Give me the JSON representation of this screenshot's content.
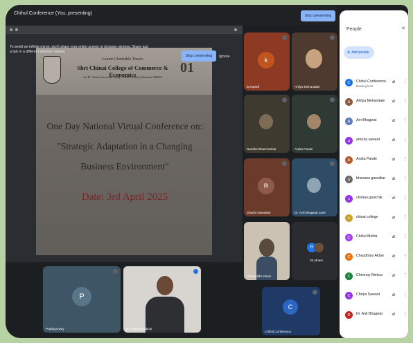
{
  "topbar": {
    "title": "Chihul Conference (You, presenting)",
    "stop_label": "Stop presenting"
  },
  "stage": {
    "notice": "To avoid an infinite mirror, don't share your entire screen or browser window. Share just a tab or a different window instead.",
    "stop_label": "Stop presenting",
    "ignore_label": "Ignore"
  },
  "slide": {
    "org_line1": "Laxmi Charitable Trust's",
    "org_line2": "Shri Chinai College of Commerce & Economics",
    "org_line3": "Sir M. Vishweshwariya Marg, Andheri (East), Mumbai 400069",
    "title_line1": "One Day National Virtual Conference on:",
    "title_line2": "\"Strategic Adaptation in a Changing",
    "title_line3": "Business Environment\"",
    "date": "Date: 3rd April 2025",
    "crest_mark": "01"
  },
  "tiles": [
    {
      "name": "kempsell",
      "initial": "k",
      "bg": "#8d3a24",
      "avatar_bg": "#c2541f"
    },
    {
      "name": "Ahilya Mehandale",
      "bg": "#4e3a2e"
    },
    {
      "name": "Nandini Bhasmankar",
      "bg": "#3f3a30"
    },
    {
      "name": "Arpita Pande",
      "bg": "#2f3a35"
    },
    {
      "name": "Shashi Hawaldar",
      "initial": "R",
      "bg": "#6a3b2b",
      "avatar_bg": "#8e5a47"
    },
    {
      "name": "Dr. Anil Bhagwat Jane",
      "bg": "#2f4c66"
    },
    {
      "name": "Shreenidhi Yelwe",
      "bg": "#cbc2b3"
    },
    {
      "name": "26 others",
      "bg": "#2a2c30"
    },
    {
      "name": "Pradnya Dey",
      "initial": "P",
      "bg": "#3e5566",
      "avatar_bg": "#587687"
    },
    {
      "name": "Dr. Prasad Sabnis",
      "bg": "#d8d4cf"
    },
    {
      "name": "Chihul Conference",
      "initial": "C",
      "bg": "#1f3a66",
      "avatar_bg": "#2c66c3"
    }
  ],
  "panel": {
    "title": "People",
    "close_icon": "close-icon",
    "add_label": "Add people",
    "people": [
      {
        "name": "Chihul Conference",
        "sub": "Meeting host",
        "initial": "C",
        "color": "#1a73e8"
      },
      {
        "name": "Ahilya Mehandale",
        "sub": "",
        "initial": "A",
        "color": "#8d5b3d"
      },
      {
        "name": "Am Bhagwat",
        "sub": "",
        "initial": "A",
        "color": "#5e7cc1"
      },
      {
        "name": "amruta sawant",
        "sub": "",
        "initial": "a",
        "color": "#9334e6"
      },
      {
        "name": "Arpita Pande",
        "sub": "",
        "initial": "A",
        "color": "#b35c2e"
      },
      {
        "name": "bhavana gawalkar",
        "sub": "",
        "initial": "b",
        "color": "#6d6b68"
      },
      {
        "name": "chintan gamchik",
        "sub": "",
        "initial": "c",
        "color": "#9334e6"
      },
      {
        "name": "chinai college",
        "sub": "",
        "initial": "c",
        "color": "#c9a227"
      },
      {
        "name": "Chihul Mehta",
        "sub": "",
        "initial": "C",
        "color": "#a142f4"
      },
      {
        "name": "Chaudhary Akbar",
        "sub": "",
        "initial": "C",
        "color": "#e8710a"
      },
      {
        "name": "Chinmay Nimkar",
        "sub": "",
        "initial": "C",
        "color": "#188038"
      },
      {
        "name": "Chirpa Sawant",
        "sub": "",
        "initial": "C",
        "color": "#9334e6"
      },
      {
        "name": "Dr. Anil Bhagwat",
        "sub": "",
        "initial": "D",
        "color": "#c5221f"
      }
    ]
  }
}
